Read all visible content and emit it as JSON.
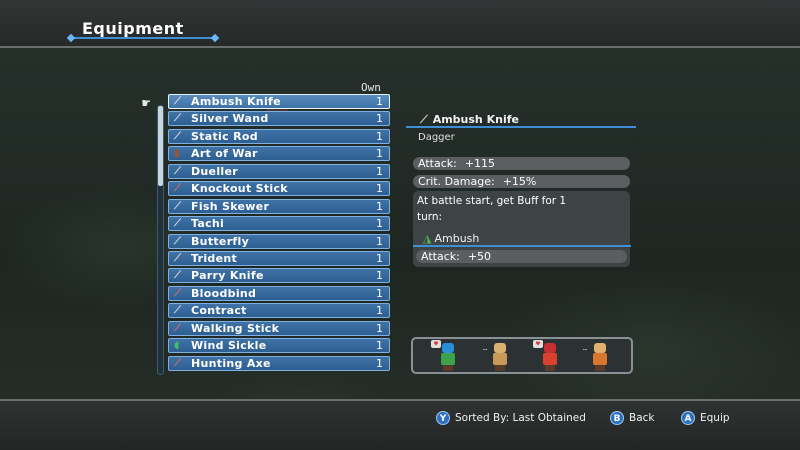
{
  "header": {
    "title": "Equipment"
  },
  "list": {
    "own_header": "Own",
    "items": [
      {
        "label": "Ambush Knife",
        "qty": "1",
        "icon": "knife-icon",
        "selected": true
      },
      {
        "label": "Silver Wand",
        "qty": "1",
        "icon": "wand-icon"
      },
      {
        "label": "Static Rod",
        "qty": "1",
        "icon": "rod-icon"
      },
      {
        "label": "Art of War",
        "qty": "1",
        "icon": "book-icon"
      },
      {
        "label": "Dueller",
        "qty": "1",
        "icon": "sword-icon"
      },
      {
        "label": "Knockout Stick",
        "qty": "1",
        "icon": "stick-icon"
      },
      {
        "label": "Fish Skewer",
        "qty": "1",
        "icon": "skewer-icon"
      },
      {
        "label": "Tachi",
        "qty": "1",
        "icon": "sword-icon"
      },
      {
        "label": "Butterfly",
        "qty": "1",
        "icon": "knife-icon"
      },
      {
        "label": "Trident",
        "qty": "1",
        "icon": "trident-icon"
      },
      {
        "label": "Parry Knife",
        "qty": "1",
        "icon": "knife-icon"
      },
      {
        "label": "Bloodbind",
        "qty": "1",
        "icon": "blade-icon"
      },
      {
        "label": "Contract",
        "qty": "1",
        "icon": "contract-icon"
      },
      {
        "label": "Walking Stick",
        "qty": "1",
        "icon": "stick-icon"
      },
      {
        "label": "Wind Sickle",
        "qty": "1",
        "icon": "sickle-icon"
      },
      {
        "label": "Hunting Axe",
        "qty": "1",
        "icon": "axe-icon"
      }
    ]
  },
  "detail": {
    "name": "Ambush Knife",
    "type": "Dagger",
    "stats": [
      {
        "label": "Attack:",
        "value": "+115"
      },
      {
        "label": "Crit. Damage:",
        "value": "+15%"
      }
    ],
    "description_line1": "At battle start, get Buff for 1",
    "description_line2": "turn:",
    "skill_name": "Ambush",
    "skill_icon": "ambush-icon",
    "skill_stat": {
      "label": "Attack:",
      "value": "+50"
    }
  },
  "party": {
    "members": [
      {
        "icon": "hero-blue-hair-icon",
        "hair": "#2a8fd8",
        "body": "#3aa34a",
        "mark": "heart"
      },
      {
        "icon": "monk-icon",
        "hair": "#d8b070",
        "body": "#c89a5a",
        "mark": "dots"
      },
      {
        "icon": "hero-red-hat-icon",
        "hair": "#c83030",
        "body": "#d84030",
        "mark": "heart"
      },
      {
        "icon": "bald-fighter-icon",
        "hair": "#e0b070",
        "body": "#d87830",
        "mark": "dots"
      }
    ]
  },
  "footer": {
    "sort_button": "Y",
    "sort_label": "Sorted By: Last Obtained",
    "back_button": "B",
    "back_label": "Back",
    "equip_button": "A",
    "equip_label": "Equip"
  },
  "colors": {
    "accent": "#3e8fd6",
    "list_item": "#3f72a6",
    "pill": "#5a5e60"
  }
}
